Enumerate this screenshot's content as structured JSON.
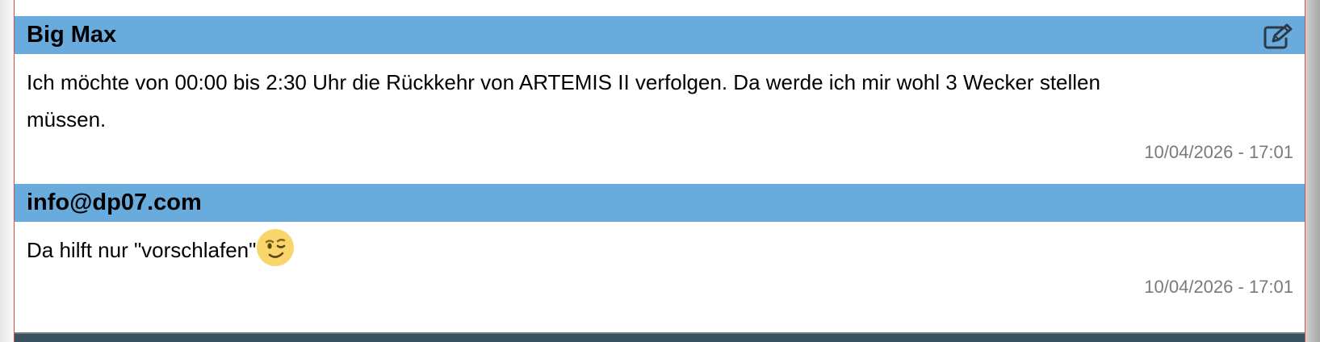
{
  "comments": [
    {
      "author": "Big Max",
      "text": "Ich möchte von 00:00 bis 2:30 Uhr die Rückkehr von ARTEMIS II verfolgen. Da werde ich mir wohl 3 Wecker stellen müssen.",
      "timestamp": "10/04/2026 - 17:01",
      "edit_icon": "edit-icon"
    },
    {
      "author": "info@dp07.com",
      "text": "Da hilft nur \"vorschlafen\"",
      "emoji": "winking-face",
      "timestamp": "10/04/2026 - 17:01"
    }
  ],
  "colors": {
    "header_bg": "#6aabde",
    "timestamp": "#7a7a7a",
    "frame_border": "#e24a4a",
    "footer_bar": "#3a5260"
  }
}
